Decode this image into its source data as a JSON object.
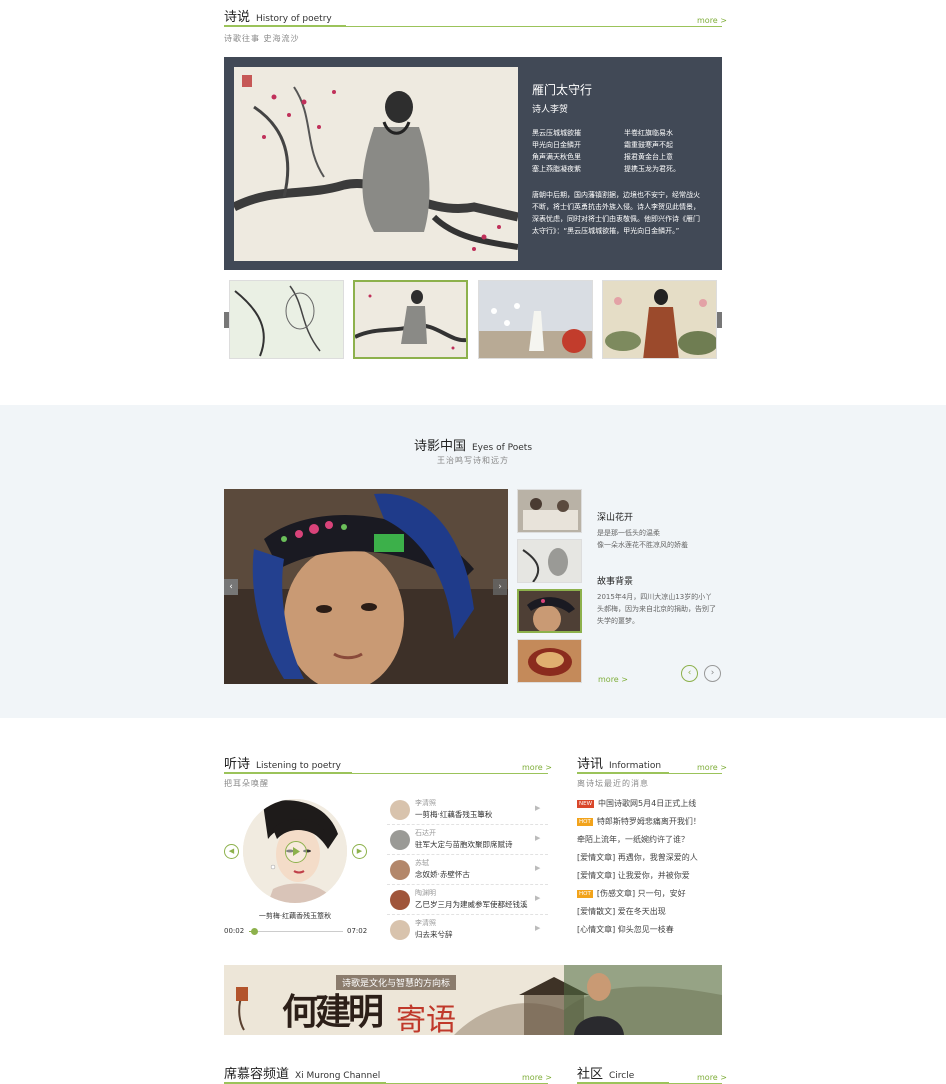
{
  "history": {
    "title": "诗说",
    "title_en": "History of poetry",
    "subtitle": "诗歌往事 史海流沙",
    "more": "more >",
    "poem_title": "雁门太守行",
    "poem_author": "诗人李贺",
    "lines_left": [
      "黑云压城城欲摧",
      "甲光向日金鳞开",
      "角声满天秋色里",
      "塞上燕脂凝夜紫"
    ],
    "lines_right": [
      "半卷红旗临易水",
      "霜重鼓寒声不起",
      "报君黄金台上意",
      "提携玉龙为君死。"
    ],
    "description": "唐朝中后期，国内藩镇割据，边境也不安宁，经常战火不断，将士们英勇抗击外族入侵。诗人李贺见此情景，深表忧虑，同时对将士们由衷敬佩。他即兴作诗《雁门太守行》：“黑云压城城欲摧，甲光向日金鳞开。”",
    "prev": "‹",
    "next": "›"
  },
  "eyes": {
    "title": "诗影中国",
    "title_en": "Eyes of Poets",
    "subtitle": "王治鸣写诗和远方",
    "story1_title": "深山花开",
    "story1_text": "是是那一低头的温柔\n像一朵水莲花不胜凉风的娇羞",
    "story2_title": "故事背景",
    "story2_text": "2015年4月，四川大凉山13岁的小丫头郝梅，因为来自北京的捐助，告别了失学的噩梦。",
    "more": "more >",
    "prev": "‹",
    "next": "›"
  },
  "listen": {
    "title": "听诗",
    "title_en": "Listening to poetry",
    "subtitle": "把耳朵唤醒",
    "more": "more >",
    "now_playing": "一剪梅·红藕香残玉簟秋",
    "time_current": "00:02",
    "time_total": "07:02",
    "progress": 0.05,
    "songs": [
      {
        "author": "李清照",
        "title": "一剪梅·红藕香残玉簟秋"
      },
      {
        "author": "石达开",
        "title": "驻军大定与苗胞欢聚即席赋诗"
      },
      {
        "author": "苏轼",
        "title": "念奴娇·赤壁怀古"
      },
      {
        "author": "陶渊明",
        "title": "乙巳岁三月为建威参军使都经钱溪"
      },
      {
        "author": "李清照",
        "title": "归去来兮辞"
      }
    ]
  },
  "info": {
    "title": "诗讯",
    "title_en": "Information",
    "subtitle": "离诗坛最近的消息",
    "more": "more >",
    "items": [
      {
        "tag": "NEW",
        "text": "中国诗歌网5月4日正式上线"
      },
      {
        "tag": "HOT",
        "text": "特郎斯特罗姆悲痛离开我们！"
      },
      {
        "tag": "",
        "text": "牵陌上流年，一纸婉约许了谁？"
      },
      {
        "tag": "",
        "text": "[爱情文章] 再遇你，我曾深爱的人"
      },
      {
        "tag": "",
        "text": "[爱情文章] 让我爱你，并被你爱"
      },
      {
        "tag": "HOT",
        "text": "[伤感文章] 只一句，安好"
      },
      {
        "tag": "",
        "text": "[爱情散文] 爱在冬天出现"
      },
      {
        "tag": "",
        "text": "[心情文章] 仰头忽见一枝春"
      }
    ]
  },
  "banner": {
    "slogan": "诗歌是文化与智慧的方向标",
    "name_big": "何建明",
    "name_red": "寄语"
  },
  "ximurong": {
    "title": "席慕容频道",
    "title_en": "Xi Murong Channel",
    "more": "more >"
  },
  "circle": {
    "title": "社区",
    "title_en": "Circle",
    "more": "more >"
  },
  "colors": {
    "accent": "#8db14c",
    "panel": "#414956",
    "band": "#f1f5f8",
    "new_tag": "#d9472b",
    "hot_tag": "#f2a31b"
  }
}
